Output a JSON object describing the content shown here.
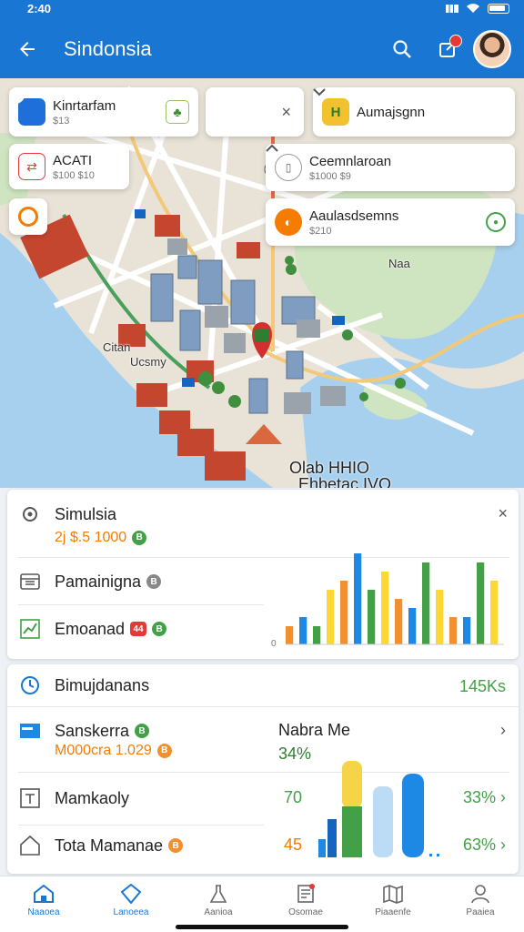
{
  "status_bar": {
    "time": "2:40"
  },
  "app_bar": {
    "title": "Sindonsia"
  },
  "map": {
    "chips": [
      {
        "name": "Kinrtarfam",
        "sub": "$13",
        "color": "#1e6fd9"
      },
      {
        "name": "",
        "sub": ""
      },
      {
        "name": "Aumajsgnn",
        "sub": "",
        "color": "#f2c12e"
      },
      {
        "name": "ACATI",
        "sub": "$100 $10",
        "color": "#e53935"
      },
      {
        "name": "Ceemnlaroan",
        "sub": "$1000 $9",
        "color": "#888888"
      },
      {
        "name": "",
        "sub": "",
        "color": "#f57c00"
      },
      {
        "name": "Aaulasdsemns",
        "sub": "$210",
        "color": "#f57c00"
      }
    ],
    "labels": {
      "place_left": "Ucsmy",
      "place_left2": "Citan",
      "place_right": "Naa",
      "area_bottom": "Olab HHIO",
      "area_bottom2": "Ehbetac IVO"
    }
  },
  "card1": {
    "title": "Simulsia",
    "title_value": "2j $.5 1000",
    "row2_label": "Pamainigna",
    "row3_label": "Emoanad",
    "row3_badge": "44",
    "chart_zero": "0"
  },
  "card2": {
    "header_label": "Bimujdanans",
    "header_value": "145Ks",
    "row1_label": "Sanskerra",
    "row1_value": "M000cra 1.029",
    "row1_mid_label": "Nabra Me",
    "row1_mid_value": "34%",
    "row2_label": "Mamkaoly",
    "row2_mid_value": "70",
    "row2_right": "33%",
    "row3_label": "Tota Mamanae",
    "row3_mid_value": "45",
    "row3_right": "63%"
  },
  "bottom_nav": [
    {
      "label": "Naaoea",
      "icon": "home-icon",
      "active": true
    },
    {
      "label": "Lanoeea",
      "icon": "map-pin-icon",
      "active": false
    },
    {
      "label": "Aanioa",
      "icon": "flask-icon",
      "active": false
    },
    {
      "label": "Osomae",
      "icon": "report-icon",
      "active": false
    },
    {
      "label": "Piaaenfe",
      "icon": "map-fold-icon",
      "active": false
    },
    {
      "label": "Paaiea",
      "icon": "profile-icon",
      "active": false
    }
  ],
  "colors": {
    "primary": "#1976d2",
    "orange": "#f2902e",
    "green": "#43a047",
    "blue": "#1e88e5",
    "yellow": "#fdd835"
  },
  "chart_data": {
    "type": "bar",
    "series": [
      {
        "values": [
          2,
          3,
          2,
          6,
          7,
          10,
          6,
          8,
          5,
          4,
          9,
          6,
          3,
          3,
          9,
          7
        ]
      }
    ],
    "ylim": [
      0,
      10
    ]
  }
}
